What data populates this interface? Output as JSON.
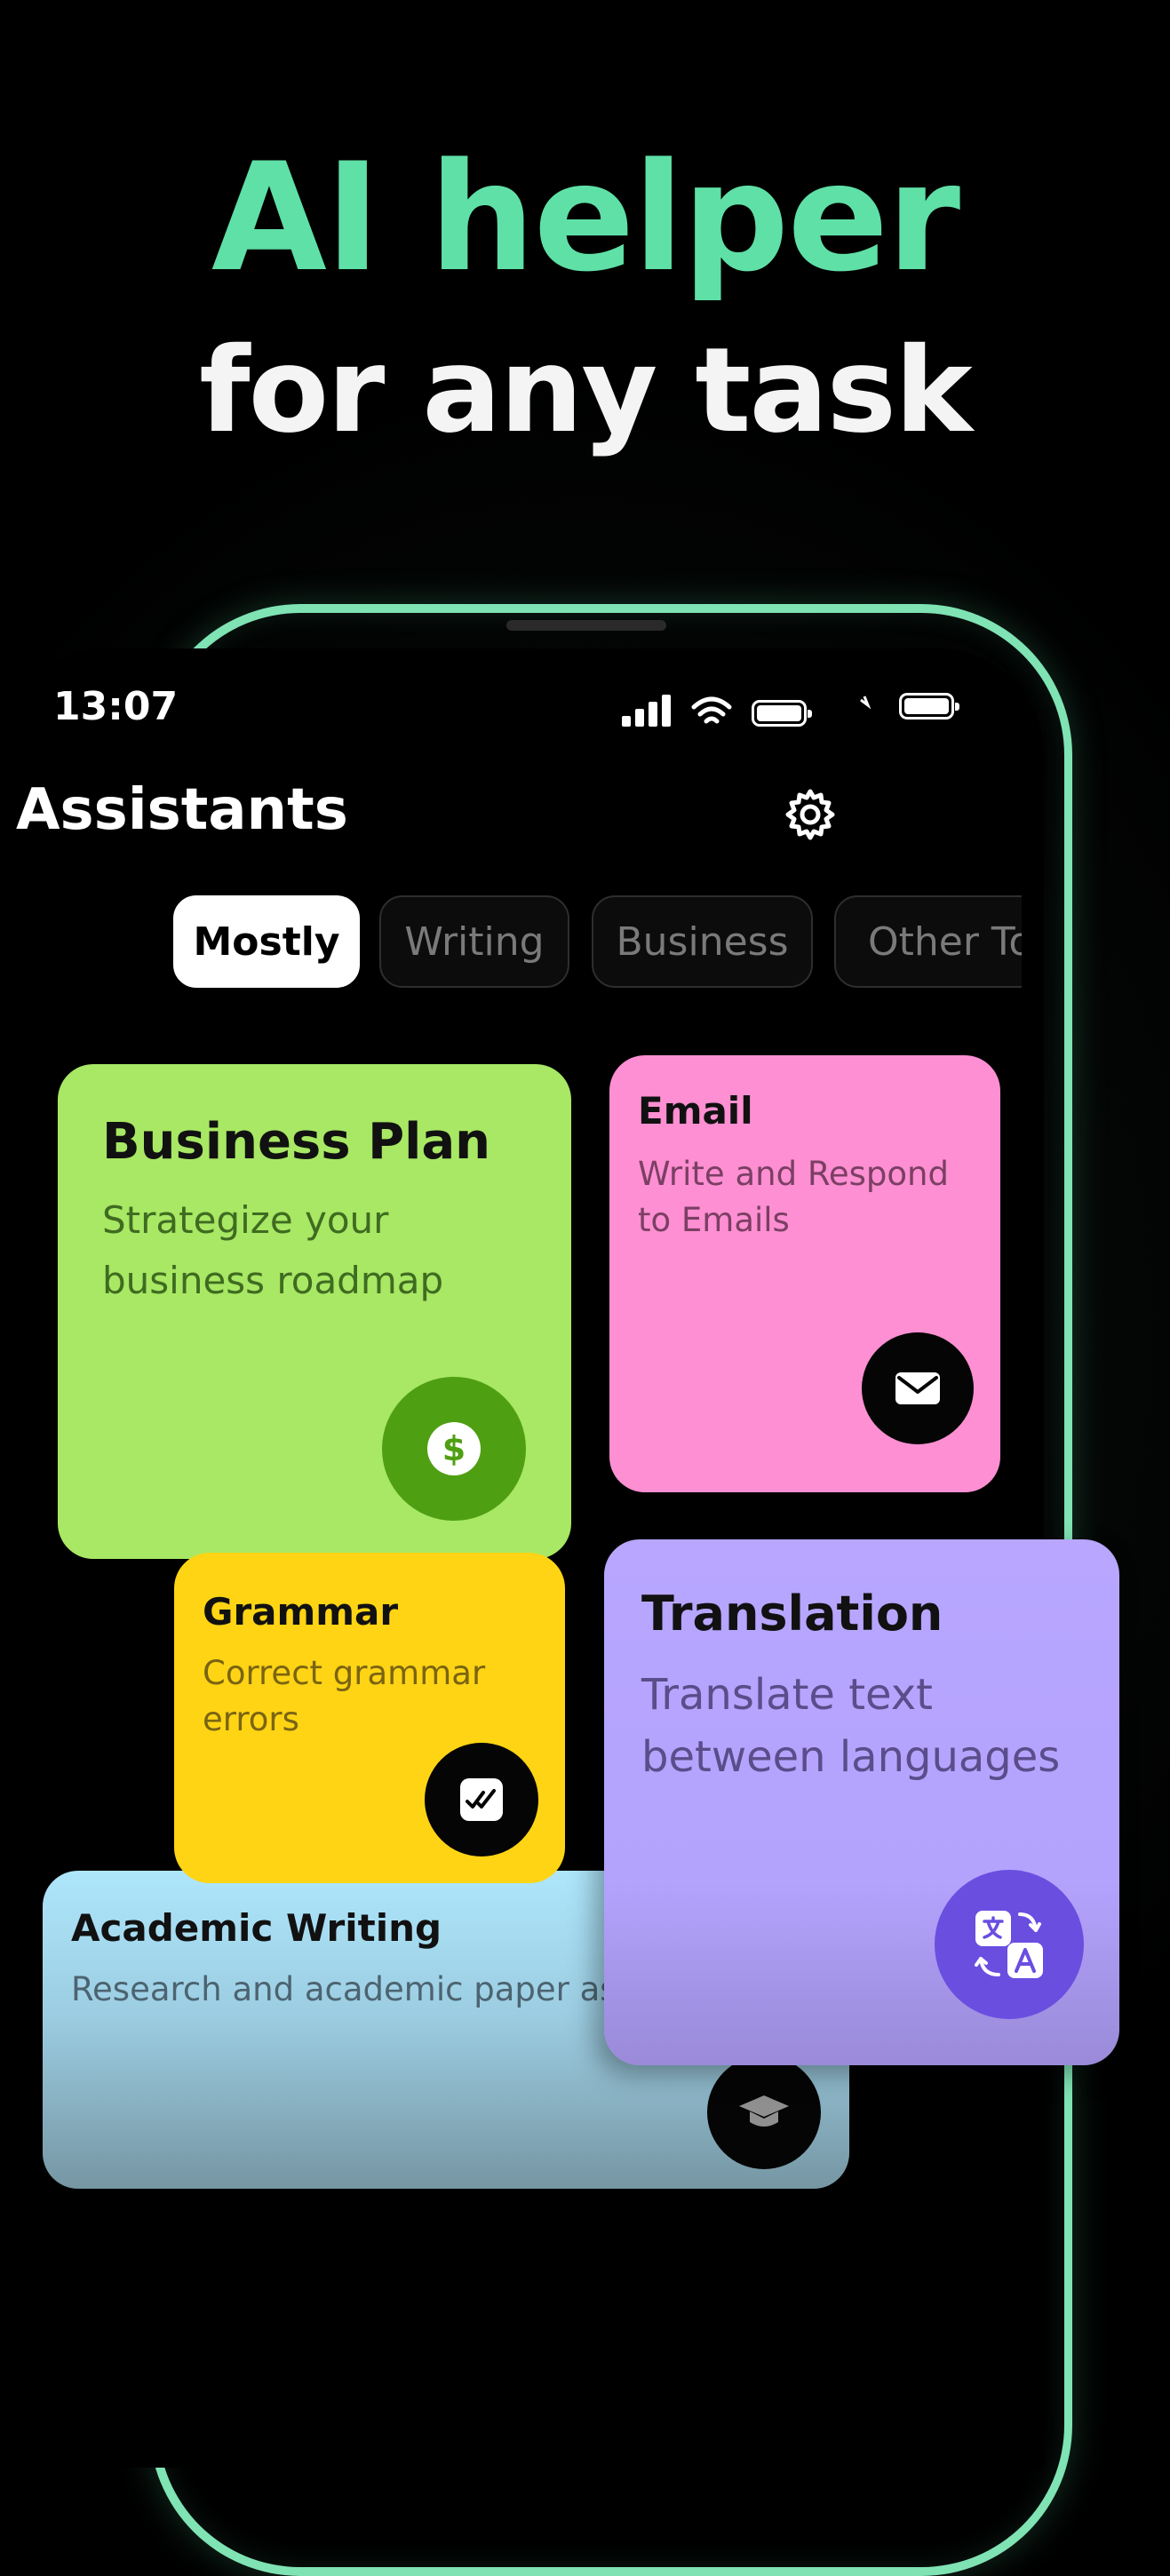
{
  "hero": {
    "line1": "AI helper",
    "line2": "for any task"
  },
  "status_bar": {
    "time": "13:07"
  },
  "header": {
    "title": "Assistants"
  },
  "tabs": [
    {
      "label": "Mostly",
      "active": true
    },
    {
      "label": "Writing",
      "active": false
    },
    {
      "label": "Business",
      "active": false
    },
    {
      "label": "Other To",
      "active": false
    }
  ],
  "cards": {
    "business_plan": {
      "title": "Business Plan",
      "desc": "Strategize your business roadmap",
      "icon": "dollar-icon",
      "color": "#a8e864"
    },
    "email": {
      "title": "Email",
      "desc": "Write and Respond to Emails",
      "icon": "mail-icon",
      "color": "#fd8fd2"
    },
    "grammar": {
      "title": "Grammar",
      "desc": "Correct grammar errors",
      "icon": "double-check-icon",
      "color": "#ffd414"
    },
    "academic": {
      "title": "Academic Writing",
      "desc": "Research and academic paper assistant",
      "icon": "graduation-cap-icon",
      "color": "#aee6fb"
    },
    "translation": {
      "title": "Translation",
      "desc": "Translate text between languages",
      "icon": "translate-icon",
      "color": "#b8a6ff"
    }
  },
  "accent_color": "#5fe0a6"
}
